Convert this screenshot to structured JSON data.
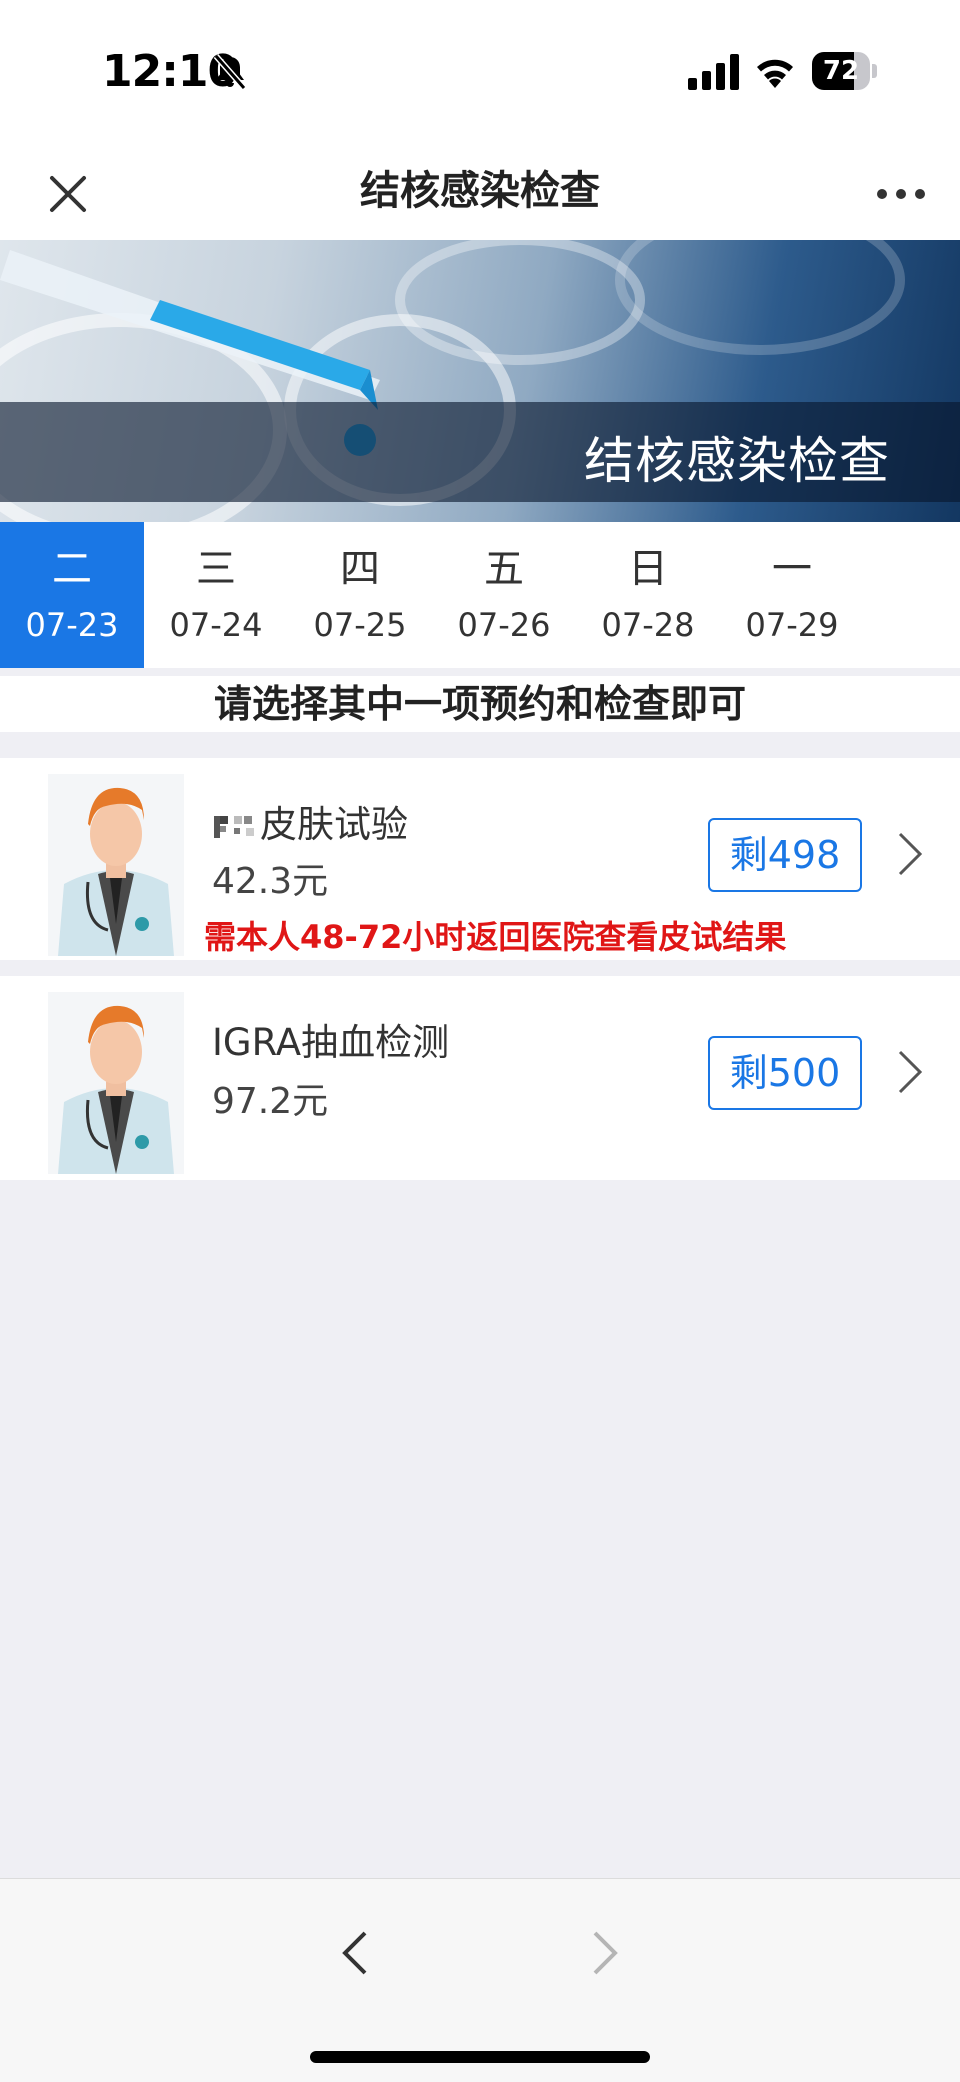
{
  "status_bar": {
    "time": "12:10",
    "battery_percent": "72",
    "battery_level": 0.72,
    "icons": [
      "bell-muted-icon",
      "cellular-signal-icon",
      "wifi-icon",
      "battery-icon"
    ]
  },
  "nav": {
    "title": "结核感染检查",
    "close_icon": "close-icon",
    "more_icon": "more-dots-icon"
  },
  "banner": {
    "title": "结核感染检查"
  },
  "dates": [
    {
      "weekday": "二",
      "date": "07-23",
      "selected": true
    },
    {
      "weekday": "三",
      "date": "07-24",
      "selected": false
    },
    {
      "weekday": "四",
      "date": "07-25",
      "selected": false
    },
    {
      "weekday": "五",
      "date": "07-26",
      "selected": false
    },
    {
      "weekday": "日",
      "date": "07-28",
      "selected": false
    },
    {
      "weekday": "一",
      "date": "07-29",
      "selected": false
    }
  ],
  "notice": "请选择其中一项预约和检查即可",
  "items": [
    {
      "name": "皮肤试验",
      "price": "42.3元",
      "remaining": "剩498",
      "note": "需本人48-72小时返回医院查看皮试结果"
    },
    {
      "name": "IGRA抽血检测",
      "price": "97.2元",
      "remaining": "剩500"
    }
  ],
  "colors": {
    "accent": "#1a77e5",
    "warning": "#e01616",
    "background": "#efeff4"
  },
  "bottom_nav": {
    "back_icon": "chevron-left-icon",
    "forward_icon": "chevron-right-icon"
  }
}
